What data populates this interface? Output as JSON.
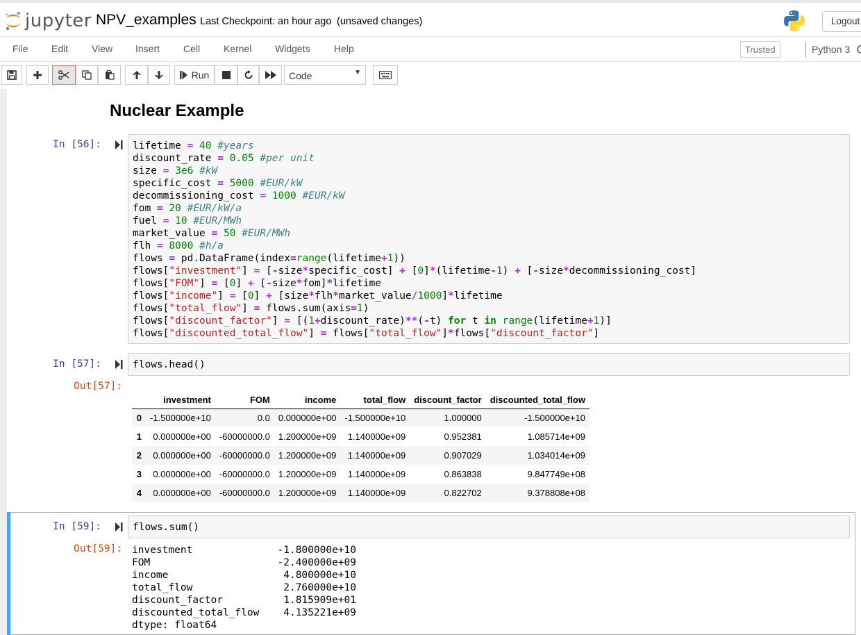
{
  "header": {
    "logo_text": "jupyter",
    "notebook_name": "NPV_examples",
    "checkpoint": "Last Checkpoint: an hour ago",
    "status": "(unsaved changes)",
    "logout_label": "Logout"
  },
  "menubar": {
    "items": [
      "File",
      "Edit",
      "View",
      "Insert",
      "Cell",
      "Kernel",
      "Widgets",
      "Help"
    ],
    "trusted_label": "Trusted",
    "kernel_name": "Python 3"
  },
  "toolbar": {
    "run_label": "Run",
    "cell_type": "Code"
  },
  "heading": "Nuclear Example",
  "cells": [
    {
      "prompt": "In [56]:",
      "code": [
        "lifetime = 40 #years",
        "discount_rate = 0.05 #per unit",
        "size = 3e6 #kW",
        "specific_cost = 5000 #EUR/kW",
        "decommissioning_cost = 1000 #EUR/kW",
        "fom = 20 #EUR/kW/a",
        "fuel = 10 #EUR/MWh",
        "market_value = 50 #EUR/MWh",
        "flh = 8000 #h/a",
        "flows = pd.DataFrame(index=range(lifetime+1))",
        "flows[\"investment\"] = [-size*specific_cost] + [0]*(lifetime-1) + [-size*decommissioning_cost]",
        "flows[\"FOM\"] = [0] + [-size*fom]*lifetime",
        "flows[\"income\"] = [0] + [size*flh*market_value/1000]*lifetime",
        "flows[\"total_flow\"] = flows.sum(axis=1)",
        "flows[\"discount_factor\"] = [(1+discount_rate)**(-t) for t in range(lifetime+1)]",
        "flows[\"discounted_total_flow\"] = flows[\"total_flow\"]*flows[\"discount_factor\"]"
      ]
    },
    {
      "prompt": "In [57]:",
      "code": [
        "flows.head()"
      ],
      "out_prompt": "Out[57]:"
    },
    {
      "prompt": "In [59]:",
      "code": [
        "flows.sum()"
      ],
      "out_prompt": "Out[59]:"
    }
  ],
  "dataframe": {
    "columns": [
      "investment",
      "FOM",
      "income",
      "total_flow",
      "discount_factor",
      "discounted_total_flow"
    ],
    "rows": [
      {
        "index": "0",
        "values": [
          "-1.500000e+10",
          "0.0",
          "0.000000e+00",
          "-1.500000e+10",
          "1.000000",
          "-1.500000e+10"
        ]
      },
      {
        "index": "1",
        "values": [
          "0.000000e+00",
          "-60000000.0",
          "1.200000e+09",
          "1.140000e+09",
          "0.952381",
          "1.085714e+09"
        ]
      },
      {
        "index": "2",
        "values": [
          "0.000000e+00",
          "-60000000.0",
          "1.200000e+09",
          "1.140000e+09",
          "0.907029",
          "1.034014e+09"
        ]
      },
      {
        "index": "3",
        "values": [
          "0.000000e+00",
          "-60000000.0",
          "1.200000e+09",
          "1.140000e+09",
          "0.863838",
          "9.847749e+08"
        ]
      },
      {
        "index": "4",
        "values": [
          "0.000000e+00",
          "-60000000.0",
          "1.200000e+09",
          "1.140000e+09",
          "0.822702",
          "9.378808e+08"
        ]
      }
    ]
  },
  "sum_output": [
    "investment              -1.800000e+10",
    "FOM                     -2.400000e+09",
    "income                   4.800000e+10",
    "total_flow               2.760000e+10",
    "discount_factor          1.815909e+01",
    "discounted_total_flow    4.135221e+09",
    "dtype: float64"
  ]
}
